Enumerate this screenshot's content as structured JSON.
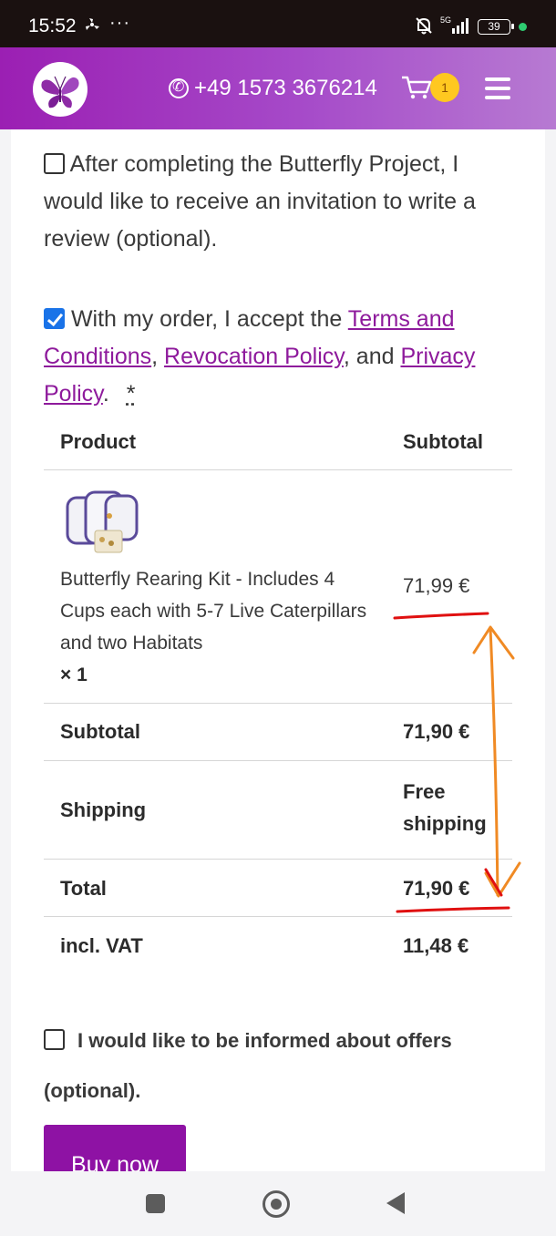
{
  "status_bar": {
    "time": "15:52",
    "dots": "···",
    "network": "5G",
    "battery": "39"
  },
  "header": {
    "phone": "+49 1573 3676214",
    "cart_count": "1"
  },
  "form": {
    "review_opt_in": {
      "checked": false,
      "text": "After completing the Butterfly Project, I would like to receive an invitation to write a review (optional)."
    },
    "terms": {
      "checked": true,
      "prefix": "With my order, I accept the",
      "terms_link": "Terms and Conditions",
      "sep": ",",
      "revocation_link": "Revocation Policy",
      "and": ", and",
      "privacy_link": "Privacy Policy",
      "end": ".",
      "required_mark": "*"
    },
    "offers_opt_in": {
      "checked": false,
      "text": "I would like to be informed about offers (optional)."
    }
  },
  "order_table": {
    "headers": {
      "product": "Product",
      "subtotal": "Subtotal"
    },
    "item": {
      "name": "Butterfly Rearing Kit - Includes 4 Cups each with 5-7 Live Caterpillars and two Habitats",
      "qty": "× 1",
      "price": "71,99 €"
    },
    "subtotal": {
      "label": "Subtotal",
      "value": "71,90 €"
    },
    "shipping": {
      "label": "Shipping",
      "value": "Free shipping"
    },
    "total": {
      "label": "Total",
      "value": "71,90 €"
    },
    "vat": {
      "label": "incl. VAT",
      "value": "11,48 €"
    }
  },
  "buy_button": "Buy now",
  "colors": {
    "brand_purple": "#8e12a4",
    "annotation_red": "#e01010",
    "annotation_orange": "#f08a24"
  },
  "icons": [
    "fan-icon",
    "mute-bell-icon",
    "signal-icon",
    "battery-icon",
    "phone-icon",
    "cart-icon",
    "menu-icon",
    "butterfly-logo-icon",
    "recents-icon",
    "home-icon",
    "back-icon"
  ]
}
